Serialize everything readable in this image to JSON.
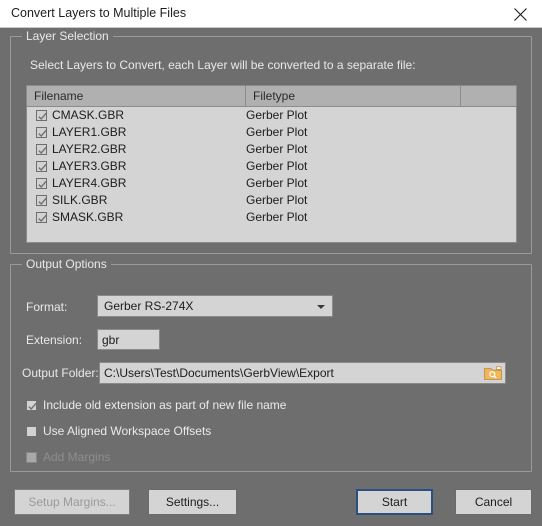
{
  "window": {
    "title": "Convert Layers to Multiple Files",
    "close_icon": "close-icon"
  },
  "layer_selection": {
    "group_title": "Layer Selection",
    "hint": "Select Layers to Convert, each Layer will be converted to a separate file:",
    "columns": [
      "Filename",
      "Filetype",
      ""
    ],
    "rows": [
      {
        "checked": true,
        "filename": "CMASK.GBR",
        "filetype": "Gerber Plot"
      },
      {
        "checked": true,
        "filename": "LAYER1.GBR",
        "filetype": "Gerber Plot"
      },
      {
        "checked": true,
        "filename": "LAYER2.GBR",
        "filetype": "Gerber Plot"
      },
      {
        "checked": true,
        "filename": "LAYER3.GBR",
        "filetype": "Gerber Plot"
      },
      {
        "checked": true,
        "filename": "LAYER4.GBR",
        "filetype": "Gerber Plot"
      },
      {
        "checked": true,
        "filename": "SILK.GBR",
        "filetype": "Gerber Plot"
      },
      {
        "checked": true,
        "filename": "SMASK.GBR",
        "filetype": "Gerber Plot"
      }
    ]
  },
  "output_options": {
    "group_title": "Output Options",
    "format_label": "Format:",
    "format_value": "Gerber RS-274X",
    "format_options": [
      "Gerber RS-274X"
    ],
    "extension_label": "Extension:",
    "extension_value": "gbr",
    "folder_label": "Output Folder:",
    "folder_value": "C:\\Users\\Test\\Documents\\GerbView\\Export",
    "browse_icon": "folder-search-icon",
    "checkboxes": [
      {
        "label": "Include old extension as part of new file name",
        "checked": true,
        "enabled": true
      },
      {
        "label": "Use Aligned Workspace Offsets",
        "checked": false,
        "enabled": true
      },
      {
        "label": "Add Margins",
        "checked": false,
        "enabled": false
      }
    ]
  },
  "buttons": {
    "setup_margins": "Setup Margins...",
    "settings": "Settings...",
    "start": "Start",
    "cancel": "Cancel"
  },
  "colors": {
    "dialog_bg": "#6e6e6e",
    "titlebar_bg": "#ffffff",
    "control_bg": "#d4d4d4",
    "header_bg": "#b0b0b0",
    "focus_border": "#2b4f80",
    "folder_icon": "#efb65e"
  }
}
